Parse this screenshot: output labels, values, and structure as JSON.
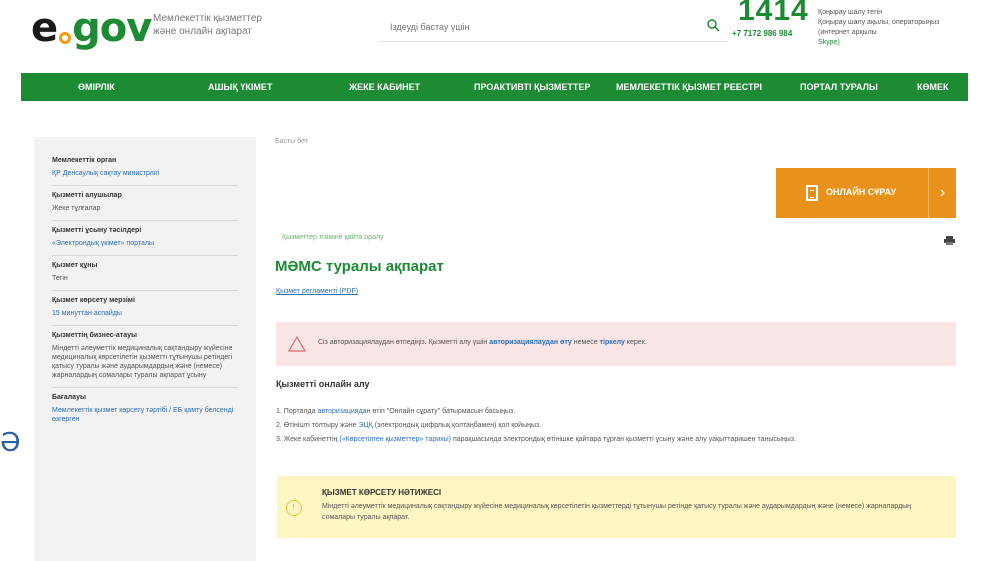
{
  "header": {
    "logo_e": "e",
    "logo_gov": "gov",
    "tagline": "Мемлекеттік қызметтер және онлайн ақпарат",
    "search_placeholder": "Іздеуді бастау үшін",
    "hotline": "1414",
    "phone": "+7 7172 986 984",
    "hotline_note_1": "Қоңырау шалу тегін",
    "hotline_note_2": "Қоңырау шалу ақылы, операторыңыз (интернет арқылы",
    "hotline_note_link": "Skype)"
  },
  "nav": {
    "items": [
      {
        "label": "ӨМІРЛІК"
      },
      {
        "label": "АШЫҚ ҮКІМЕТ"
      },
      {
        "label": "ЖЕКЕ КАБИНЕТ"
      },
      {
        "label": "ПРОАКТИВТІ ҚЫЗМЕТТЕР"
      },
      {
        "label": "МЕМЛЕКЕТТІК ҚЫЗМЕТ РЕЕСТРІ"
      },
      {
        "label": "ПОРТАЛ ТУРАЛЫ"
      },
      {
        "label": "КӨМЕК"
      }
    ]
  },
  "sidebar": {
    "sections": [
      {
        "title": "Мемлекеттік орган",
        "value": "ҚР Денсаулық сақтау министрлігі",
        "link": true
      },
      {
        "title": "Қызметті алушылар",
        "value": "Жеке тұлғалар",
        "link": false
      },
      {
        "title": "Қызметті ұсыну тәсілдері",
        "value": "«Электрондық үкімет» порталы",
        "link": true
      },
      {
        "title": "Қызмет құны",
        "value": "Тегін",
        "link": false
      },
      {
        "title": "Қызмет көрсету мерзімі",
        "value": "15 минуттан аспайды",
        "link": true
      },
      {
        "title": "Қызметтің бизнес-атауы",
        "value": "Міндетті әлеуметтік медициналық сақтандыру жүйесіне медициналық көрсетілетін қызметті тұтынушы ретіндегі қатысу туралы және аударымдардың және (немесе) жарналардың сомалары туралы ақпарат ұсыну",
        "link": false
      },
      {
        "title": "Бағалауы",
        "value": "Мемлекеттік қызмет көрсету тәртібі / ЕБ қамту белсенді өзгерген",
        "link": true
      }
    ]
  },
  "main": {
    "edge_glyph": "Ә",
    "breadcrumb": "Басты бет",
    "online_button_label": "ОНЛАЙН СҰРАУ",
    "online_button_arrow": "›",
    "back_link": "Қызметтер тізіміне қайта оралу",
    "page_title": "МӘМС туралы ақпарат",
    "reglament_link": "Қызмет регламенті (PDF)",
    "alert_text_pre": "Сіз авторизациялаудан өтпедіңіз. Қызметті алу үшін ",
    "alert_link_1": "авторизациялаудан өту",
    "alert_text_mid": " немесе ",
    "alert_link_2": "тіркелу",
    "alert_text_post": " керек.",
    "online_section_title": "Қызметті онлайн алу",
    "step1_pre": "1. Порталда ",
    "step1_link": "авторизациядан",
    "step1_post": " өтіп \"Онлайн сұрату\" батырмасын басыңыз.",
    "step2_pre": "2. Өтінішті толтыру және ",
    "step2_link": "ЭЦҚ",
    "step2_post": " (электрондық цифрлық қолтаңбамен) қол қойыңыз.",
    "step3_pre": "3. Жеке кабинеттің ",
    "step3_link": "(«Көрсетілген қызметтер» тарихы)",
    "step3_post": " парақшасында электрондық өтінішке қайтара тұрған қызметті ұсыну және алу уақыттаришен танысыңыз.",
    "result_title": "ҚЫЗМЕТ КӨРСЕТУ НӘТИЖЕСІ",
    "result_text": "Міндетті әлеуметтік медициналық сақтандыру жүйесіне медициналық көрсетілетін қызметтерді тұтынушы ретінде қатысу туралы және аударымдардың және (немесе) жарналардың сомалары туралы ақпарат."
  },
  "colors": {
    "brand_green": "#1d8a34",
    "accent_orange": "#e8921c",
    "alert_bg": "#f9e4e6",
    "result_bg": "#fdf6c3"
  }
}
